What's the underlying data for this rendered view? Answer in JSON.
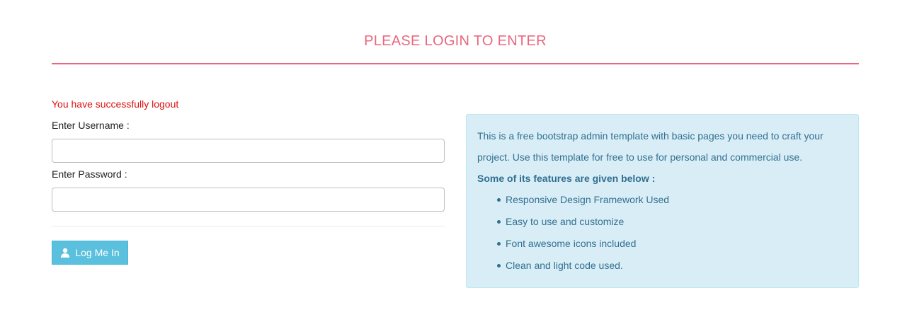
{
  "header": {
    "title": "PLEASE LOGIN TO ENTER"
  },
  "login_form": {
    "status_message": "You have successfully logout",
    "username_label": "Enter Username :",
    "username_value": "",
    "username_placeholder": "",
    "password_label": "Enter Password :",
    "password_value": "",
    "password_placeholder": "",
    "submit_label": "Log Me In",
    "submit_icon": "user-icon"
  },
  "info_panel": {
    "description": "This is a free bootstrap admin template with basic pages you need to craft your project. Use this template for free to use for personal and commercial use.",
    "features_heading": "Some of its features are given below :",
    "features": [
      "Responsive Design Framework Used",
      "Easy to use and customize",
      "Font awesome icons included",
      "Clean and light code used."
    ]
  },
  "colors": {
    "accent": "#e9687e",
    "error": "#e01010",
    "button": "#5bc0de",
    "info_bg": "#d9edf7",
    "info_text": "#31708f"
  }
}
